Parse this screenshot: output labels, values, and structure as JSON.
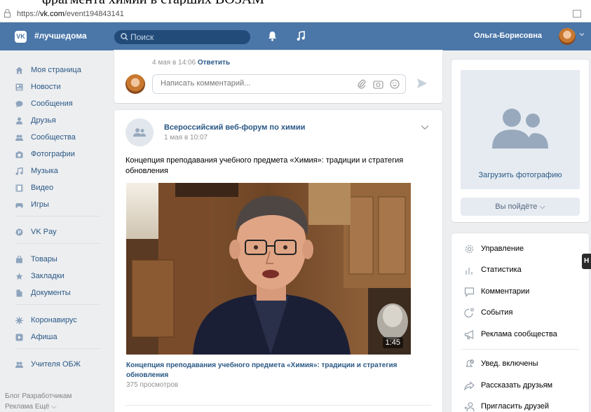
{
  "document_top_text": "фрагмента химии в старших ВОЗАМ",
  "browser": {
    "url_prefix": "https://",
    "url_domain": "vk.com",
    "url_path": "/event194843141"
  },
  "header": {
    "site_name": "#лучшедома",
    "search_placeholder": "Поиск",
    "user_name": "Ольга-Борисовна"
  },
  "left_menu": {
    "items": [
      {
        "label": "Моя страница",
        "icon": "home-icon"
      },
      {
        "label": "Новости",
        "icon": "news-icon"
      },
      {
        "label": "Сообщения",
        "icon": "messages-icon"
      },
      {
        "label": "Друзья",
        "icon": "friends-icon"
      },
      {
        "label": "Сообщества",
        "icon": "groups-icon"
      },
      {
        "label": "Фотографии",
        "icon": "camera-icon"
      },
      {
        "label": "Музыка",
        "icon": "music-icon"
      },
      {
        "label": "Видео",
        "icon": "video-icon"
      },
      {
        "label": "Игры",
        "icon": "games-icon"
      },
      {
        "label": "VK Pay",
        "icon": "vkpay-icon"
      },
      {
        "label": "Товары",
        "icon": "bag-icon"
      },
      {
        "label": "Закладки",
        "icon": "star-icon"
      },
      {
        "label": "Документы",
        "icon": "document-icon"
      },
      {
        "label": "Коронавирус",
        "icon": "virus-icon"
      },
      {
        "label": "Афиша",
        "icon": "poster-icon"
      },
      {
        "label": "Учителя ОБЖ",
        "icon": "groups-icon"
      }
    ],
    "footer_line1": "Блог  Разработчикам",
    "footer_line2": "Реклама  Ещё ⌵"
  },
  "comment_card": {
    "cut_text": "...",
    "date": "4 мая в 14:06",
    "reply_label": "Ответить",
    "comment_placeholder": "Написать комментарий..."
  },
  "post": {
    "author": "Всероссийский веб-форум по химии",
    "date": "1 мая в 10:07",
    "text": "Концепция преподавания учебного предмета «Химия»: традиции и стратегия обновления",
    "video_duration": "1:45",
    "video_title": "Концепция преподавания учебного предмета «Химия»: традиции и стратегия обновления",
    "views": "375 просмотров"
  },
  "event_panel": {
    "upload_photo_label": "Загрузить фотографию",
    "going_label": "Вы пойдёте ⌵"
  },
  "actions": {
    "items": [
      {
        "label": "Управление",
        "icon": "gear-icon"
      },
      {
        "label": "Статистика",
        "icon": "stats-icon"
      },
      {
        "label": "Комментарии",
        "icon": "comment-icon"
      },
      {
        "label": "События",
        "icon": "event-icon"
      },
      {
        "label": "Реклама сообщества",
        "icon": "megaphone-icon"
      },
      {
        "label": "Увед. включены",
        "icon": "bell-icon"
      },
      {
        "label": "Рассказать друзьям",
        "icon": "share-icon"
      },
      {
        "label": "Пригласить друзей",
        "icon": "add-friend-icon"
      }
    ]
  },
  "edge_tab_label": "Н",
  "colors": {
    "brand": "#4a76a8",
    "link": "#2a5885",
    "bg": "#edeef0",
    "search_bg": "#224b7a"
  }
}
